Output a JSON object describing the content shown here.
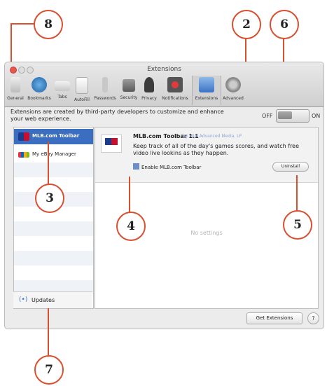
{
  "window": {
    "title": "Extensions",
    "toolbar": [
      {
        "label": "General",
        "icon": "general-icon"
      },
      {
        "label": "Bookmarks",
        "icon": "bookmarks-icon"
      },
      {
        "label": "Tabs",
        "icon": "tabs-icon"
      },
      {
        "label": "AutoFill",
        "icon": "autofill-icon"
      },
      {
        "label": "Passwords",
        "icon": "passwords-icon"
      },
      {
        "label": "Security",
        "icon": "security-icon"
      },
      {
        "label": "Privacy",
        "icon": "privacy-icon"
      },
      {
        "label": "Notifications",
        "icon": "notifications-icon"
      },
      {
        "label": "Extensions",
        "icon": "extensions-icon"
      },
      {
        "label": "Advanced",
        "icon": "advanced-icon"
      }
    ],
    "description": "Extensions are created by third-party developers to customize and enhance your web experience.",
    "toggle": {
      "off": "OFF",
      "on": "ON"
    }
  },
  "sidebar": {
    "items": [
      {
        "label": "MLB.com Toolbar",
        "selected": true
      },
      {
        "label": "My eBay Manager",
        "selected": false
      }
    ],
    "updates": "Updates"
  },
  "detail": {
    "name": "MLB.com Toolbar 1.1",
    "author": "by MLB Advanced Media, LP",
    "description": "Keep track of all of the day's games scores, and watch free video live lookins as they happen.",
    "enable_label": "Enable MLB.com Toolbar",
    "uninstall": "Uninstall",
    "no_settings": "No settings"
  },
  "footer": {
    "get_extensions": "Get Extensions",
    "help": "?"
  },
  "callouts": [
    "8",
    "2",
    "6",
    "3",
    "4",
    "5",
    "7"
  ],
  "colors": {
    "callout": "#d8502f",
    "selection": "#3b6ec0"
  }
}
